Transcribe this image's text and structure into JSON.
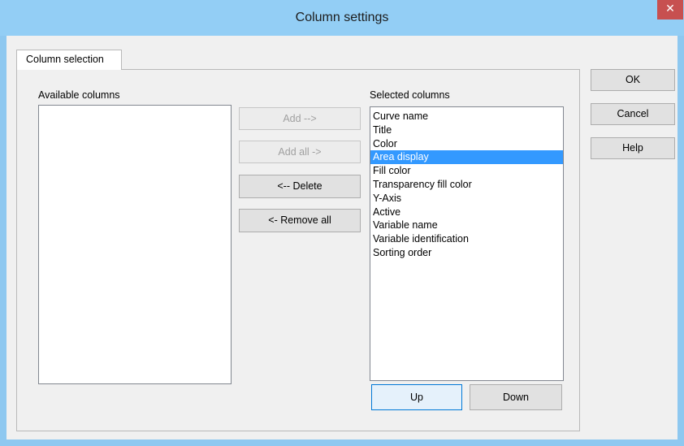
{
  "window": {
    "title": "Column settings",
    "close_label": "✕"
  },
  "tabs": [
    {
      "label": "Column selection"
    }
  ],
  "available": {
    "label": "Available columns",
    "items": []
  },
  "selected": {
    "label": "Selected columns",
    "selected_item": "Area display",
    "items": [
      "Curve name",
      "Title",
      "Color",
      "Area display",
      "Fill color",
      "Transparency fill color",
      "Y-Axis",
      "Active",
      "Variable name",
      "Variable identification",
      "Sorting order"
    ]
  },
  "middle_buttons": {
    "add": "Add -->",
    "add_all": "Add all ->",
    "delete": "<-- Delete",
    "remove_all": "<- Remove all"
  },
  "order_buttons": {
    "up": "Up",
    "down": "Down"
  },
  "dialog_buttons": {
    "ok": "OK",
    "cancel": "Cancel",
    "help": "Help"
  },
  "colors": {
    "titlebar": "#93cef5",
    "selection": "#3399ff",
    "close": "#c75050"
  }
}
